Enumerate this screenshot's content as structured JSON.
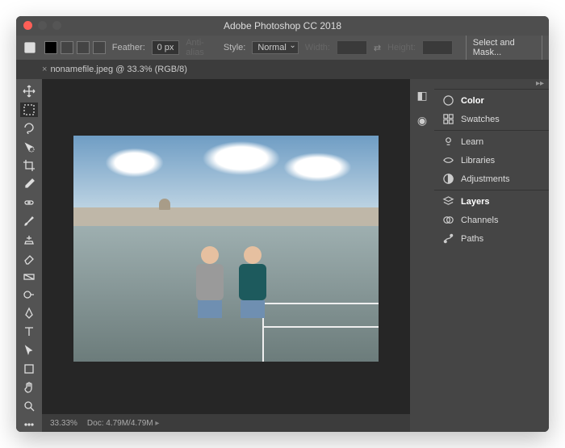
{
  "window": {
    "title": "Adobe Photoshop CC 2018"
  },
  "optionsBar": {
    "featherLabel": "Feather:",
    "featherValue": "0 px",
    "antiAlias": "Anti-alias",
    "styleLabel": "Style:",
    "styleValue": "Normal",
    "widthLabel": "Width:",
    "heightLabel": "Height:",
    "selectAndMask": "Select and Mask..."
  },
  "tab": {
    "label": "nonamefile.jpeg @ 33.3% (RGB/8)",
    "close": "×"
  },
  "status": {
    "zoom": "33.33%",
    "doc": "Doc: 4.79M/4.79M"
  },
  "panels": {
    "color": "Color",
    "swatches": "Swatches",
    "learn": "Learn",
    "libraries": "Libraries",
    "adjustments": "Adjustments",
    "layers": "Layers",
    "channels": "Channels",
    "paths": "Paths"
  }
}
